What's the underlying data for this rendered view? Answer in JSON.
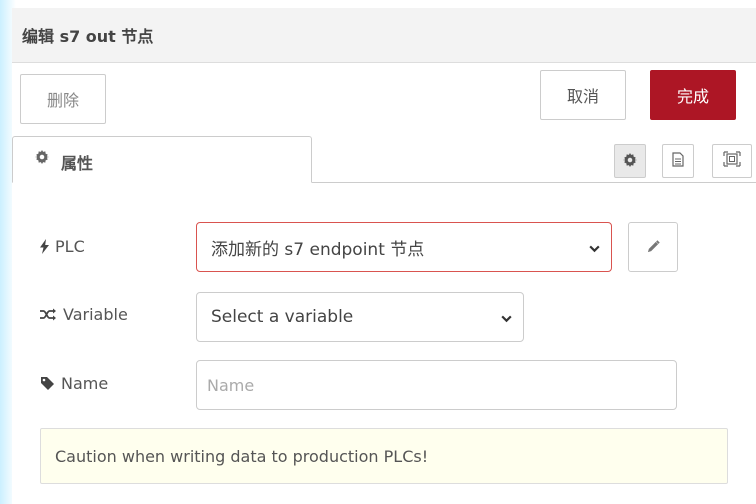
{
  "header": {
    "title": "编辑 s7 out 节点"
  },
  "toolbar": {
    "delete_label": "删除",
    "cancel_label": "取消",
    "done_label": "完成"
  },
  "tabs": [
    {
      "label": "属性",
      "icon": "gear-icon"
    }
  ],
  "tab_tools": [
    "gear-icon",
    "file-icon",
    "frame-icon"
  ],
  "form": {
    "plc": {
      "label": "PLC",
      "icon": "bolt-icon",
      "selected": "添加新的 s7 endpoint 节点"
    },
    "variable": {
      "label": "Variable",
      "icon": "random-icon",
      "selected": "Select a variable"
    },
    "name": {
      "label": "Name",
      "icon": "tag-icon",
      "value": "",
      "placeholder": "Name"
    }
  },
  "notice": {
    "text": "Caution when writing data to production PLCs!"
  },
  "colors": {
    "primary": "#ad1625",
    "error_border": "#d9534f",
    "notice_bg": "#ffffee"
  }
}
